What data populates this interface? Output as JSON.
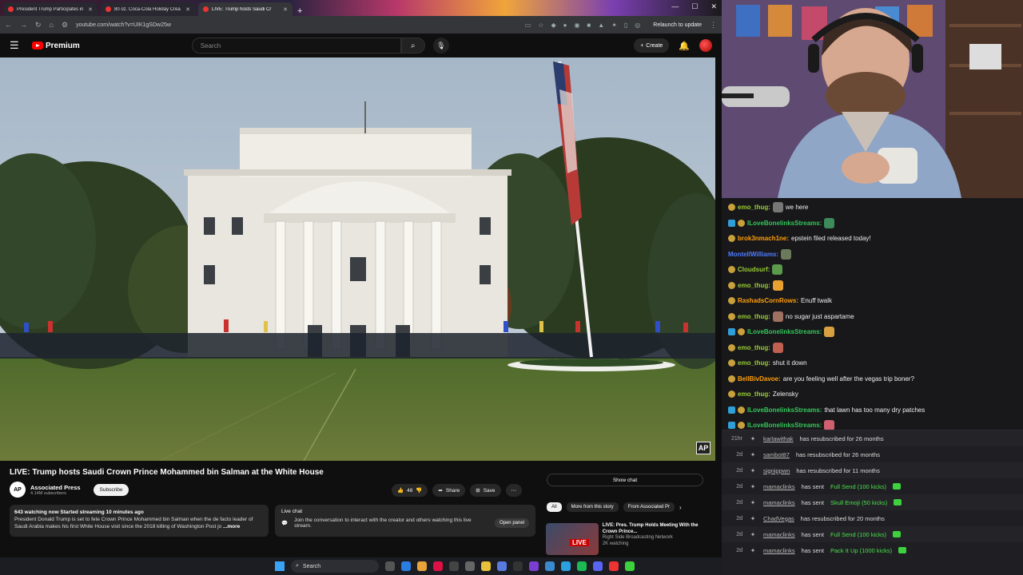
{
  "browser": {
    "tabs": [
      {
        "title": "President Trump Participates in"
      },
      {
        "title": "80 oz. Coca-Cola Holiday Crea"
      },
      {
        "title": "LIVE: Trump hosts Saudi Cr"
      }
    ],
    "url": "youtube.com/watch?v=UIK1gSDw25w",
    "relaunch_label": "Relaunch to update"
  },
  "youtube": {
    "logo_text": "Premium",
    "search_placeholder": "Search",
    "create_label": "Create",
    "video_title": "LIVE: Trump hosts Saudi Crown Prince Mohammed bin Salman at the White House",
    "watermark": "AP",
    "channel_name": "Associated Press",
    "channel_logo": "AP",
    "subscribers": "4.14M subscribers",
    "subscribe_label": "Subscribe",
    "likes": "48",
    "share_label": "Share",
    "save_label": "Save",
    "description_stats": "643 watching now  Started streaming 10 minutes ago",
    "description_text": "President Donald Trump is set to fete Crown Prince Mohammed bin Salman when the de facto leader of Saudi Arabia makes his first White House visit since the 2018 killing of Washington Post jo",
    "more_label": "...more",
    "live_chat_title": "Live chat",
    "live_chat_text": "Join the conversation to interact with the creator and others watching this live stream.",
    "open_panel_label": "Open panel",
    "show_chat_label": "Show chat",
    "chips": [
      "All",
      "More from this story",
      "From Associated Pr"
    ],
    "rec": {
      "title": "LIVE: Pres. Trump Holds Meeting With the Crown Prince...",
      "channel": "Right Side Broadcasting Network",
      "viewers": "2K watching",
      "badge": "LIVE"
    }
  },
  "taskbar": {
    "search_label": "Search"
  },
  "chat": [
    {
      "user": "emo_thug:",
      "color": "#9acd32",
      "text": "we here",
      "prime": false,
      "emote": "#777"
    },
    {
      "user": "ILoveBonelinksStreams:",
      "color": "#34c759",
      "text": "",
      "prime": true,
      "emote": "#3d8a5a"
    },
    {
      "user": "brok3nmach1ne:",
      "color": "#ff9f0a",
      "text": "epstein filed released today!",
      "prime": false,
      "emote": ""
    },
    {
      "user": "MontellWilliams:",
      "color": "#4f7cff",
      "text": "",
      "prime": false,
      "emote": "#6a7a5a",
      "nobadge": true
    },
    {
      "user": "Cloudsurf:",
      "color": "#9acd32",
      "text": "",
      "prime": false,
      "emote": "#5a9a4a"
    },
    {
      "user": "emo_thug:",
      "color": "#9acd32",
      "text": "",
      "prime": false,
      "emote": "#e8a030"
    },
    {
      "user": "RashadsCornRows:",
      "color": "#ff9f0a",
      "text": "Enuff twalk",
      "prime": false,
      "emote": ""
    },
    {
      "user": "emo_thug:",
      "color": "#9acd32",
      "text": "no sugar just aspartame",
      "prime": false,
      "emote": "#a07060"
    },
    {
      "user": "ILoveBonelinksStreams:",
      "color": "#34c759",
      "text": "",
      "prime": true,
      "emote": "#d8a040"
    },
    {
      "user": "emo_thug:",
      "color": "#9acd32",
      "text": "",
      "prime": false,
      "emote": "#c06050"
    },
    {
      "user": "emo_thug:",
      "color": "#9acd32",
      "text": "shut it down",
      "prime": false,
      "emote": ""
    },
    {
      "user": "BellBivDavoe:",
      "color": "#ff9f0a",
      "text": "are you feeling well after the vegas trip boner?",
      "prime": false,
      "emote": ""
    },
    {
      "user": "emo_thug:",
      "color": "#9acd32",
      "text": "Zelensky",
      "prime": false,
      "emote": ""
    },
    {
      "user": "ILoveBonelinksStreams:",
      "color": "#34c759",
      "text": "that lawn has too many dry patches",
      "prime": true,
      "emote": ""
    },
    {
      "user": "ILoveBonelinksStreams:",
      "color": "#34c759",
      "text": "",
      "prime": true,
      "emote": "#d06070"
    }
  ],
  "events": [
    {
      "time": "21hr",
      "user": "karlawithak",
      "text": "has resubscribed for 26 months",
      "kick": ""
    },
    {
      "time": "2d",
      "user": "sambot87",
      "text": "has resubscribed for 26 months",
      "kick": ""
    },
    {
      "time": "2d",
      "user": "signippwn",
      "text": "has resubscribed for 11 months",
      "kick": ""
    },
    {
      "time": "2d",
      "user": "mamaclinks",
      "text": "has sent",
      "kick": "Full Send (100 kicks)"
    },
    {
      "time": "2d",
      "user": "mamaclinks",
      "text": "has sent",
      "kick": "Skull Emoji (50 kicks)"
    },
    {
      "time": "2d",
      "user": "ChadVegas",
      "text": "has resubscribed for 20 months",
      "kick": ""
    },
    {
      "time": "2d",
      "user": "mamaclinks",
      "text": "has sent",
      "kick": "Full Send (100 kicks)"
    },
    {
      "time": "2d",
      "user": "mamaclinks",
      "text": "has sent",
      "kick": "Pack It Up (1000 kicks)"
    }
  ]
}
